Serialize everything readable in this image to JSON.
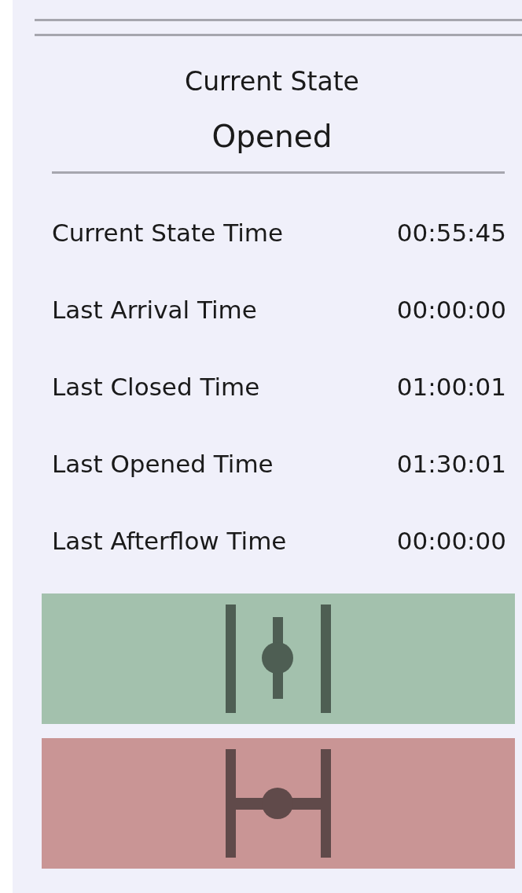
{
  "header": {
    "title": "Current State",
    "state": "Opened"
  },
  "times": [
    {
      "label": "Current State Time",
      "value": "00:55:45"
    },
    {
      "label": "Last Arrival Time",
      "value": "00:00:00"
    },
    {
      "label": "Last Closed Time",
      "value": "01:00:01"
    },
    {
      "label": "Last Opened Time",
      "value": "01:30:01"
    },
    {
      "label": "Last Afterflow Time",
      "value": "00:00:00"
    }
  ],
  "buttons": [
    {
      "kind": "open",
      "color": "#a3c1ad"
    },
    {
      "kind": "close",
      "color": "#c99595"
    }
  ]
}
